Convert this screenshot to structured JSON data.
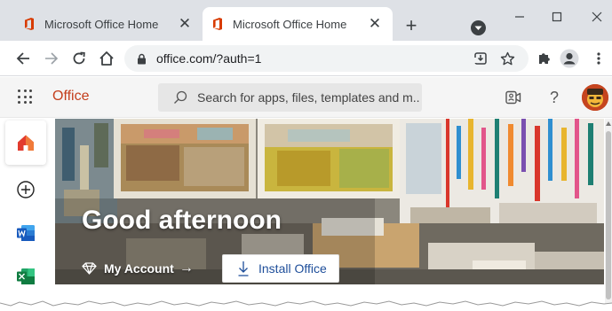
{
  "browser": {
    "tabs": [
      {
        "title": "Microsoft Office Home",
        "active": false
      },
      {
        "title": "Microsoft Office Home",
        "active": true
      }
    ],
    "new_tab_label": "+",
    "address": {
      "url": "office.com/?auth=1"
    }
  },
  "office": {
    "brand": "Office",
    "search": {
      "placeholder": "Search for apps, files, templates and m..."
    },
    "help_label": "?",
    "hero": {
      "greeting": "Good afternoon",
      "my_account": "My Account",
      "install_label": "Install Office"
    },
    "rail": [
      "home",
      "create",
      "word",
      "excel"
    ]
  },
  "colors": {
    "office_brand": "#c43e1c",
    "link_blue": "#1e4e9a",
    "tab_strip": "#dee1e6",
    "word_blue": "#185abd",
    "excel_green": "#107c41"
  }
}
